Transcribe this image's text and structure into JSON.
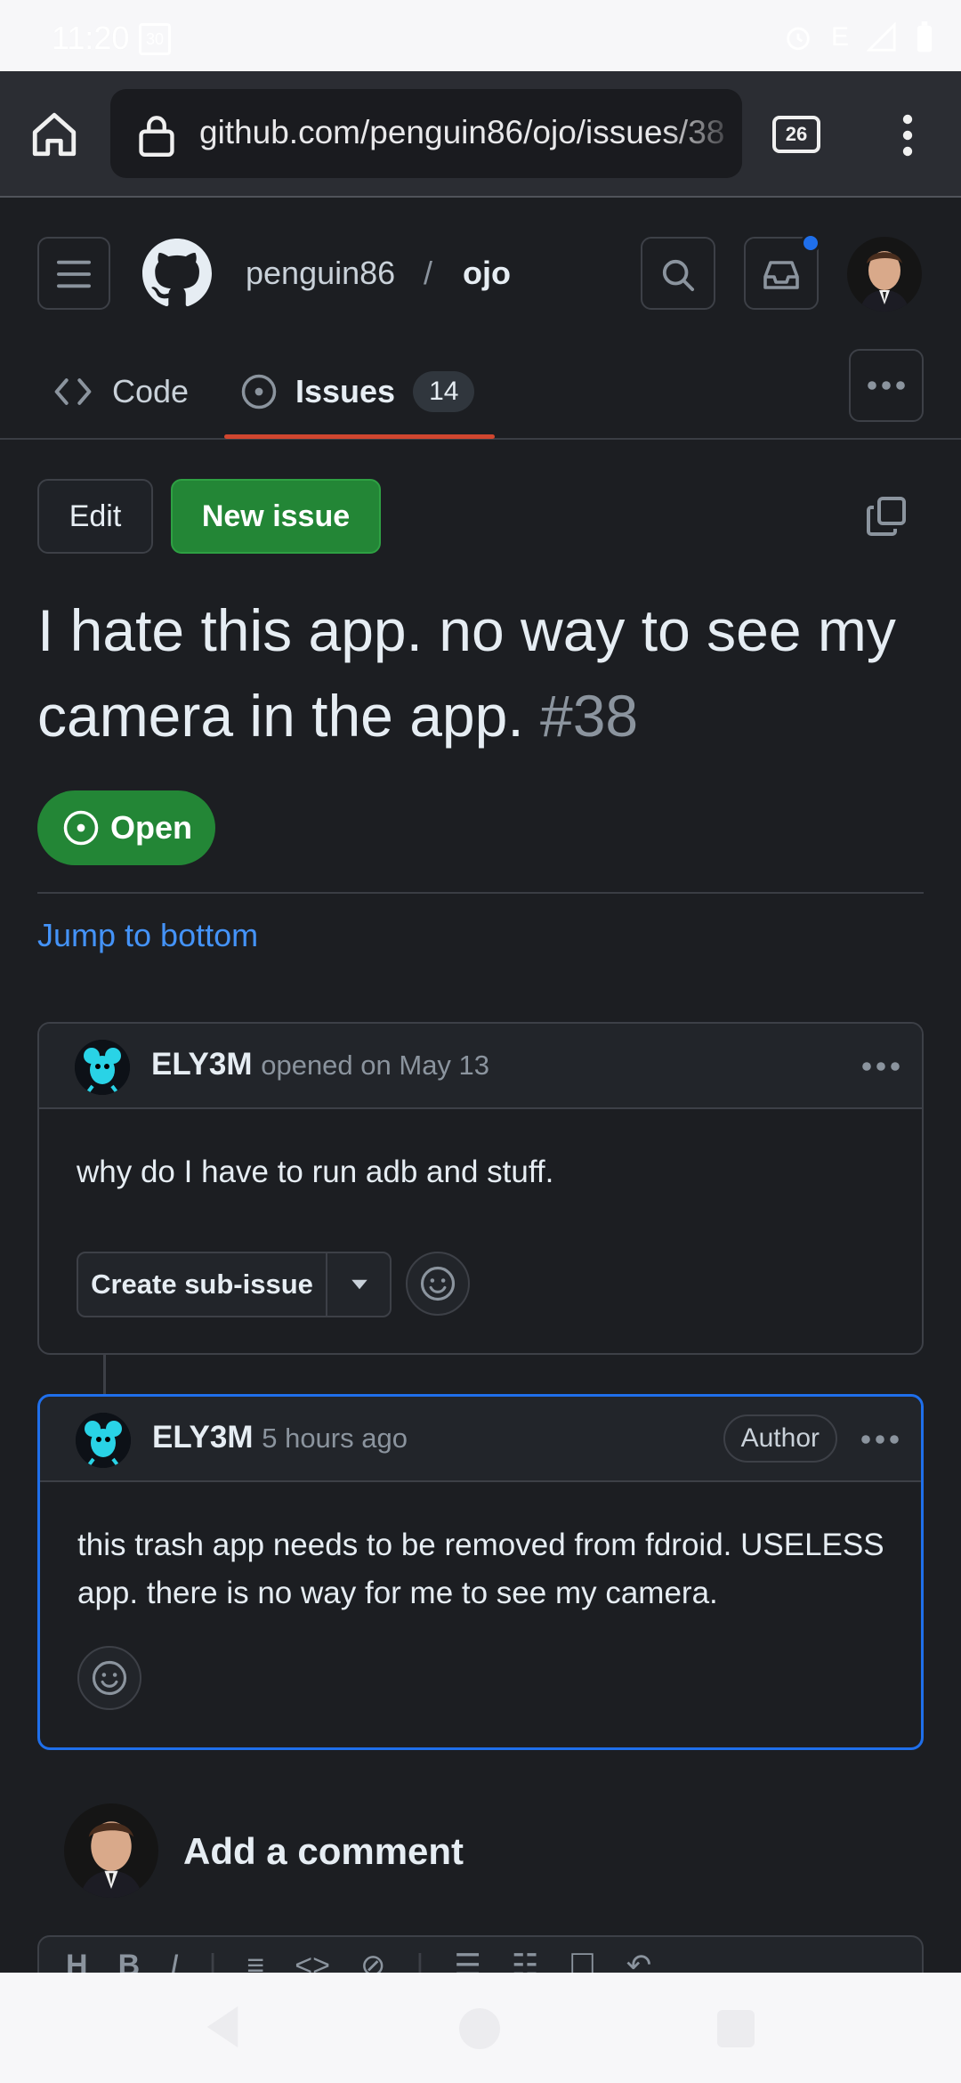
{
  "status_bar": {
    "time": "11:20",
    "calendar_day": "30",
    "network": "E"
  },
  "browser": {
    "url": "github.com/penguin86/ojo/issues/38",
    "tab_count": "26"
  },
  "header": {
    "owner": "penguin86",
    "separator": "/",
    "repo": "ojo",
    "tabs": [
      {
        "label": "Code"
      },
      {
        "label": "Issues",
        "count": "14"
      }
    ]
  },
  "actions": {
    "edit_label": "Edit",
    "new_issue_label": "New issue"
  },
  "issue": {
    "title": "I hate this app. no way to see my camera in the app.",
    "number": "#38",
    "state": "Open",
    "jump_link": "Jump to bottom"
  },
  "comments": [
    {
      "author": "ELY3M",
      "meta": "opened on May 13",
      "body": "why do I have to run adb and stuff.",
      "sub_issue_label": "Create sub-issue"
    },
    {
      "author": "ELY3M",
      "meta": "5 hours ago",
      "badge": "Author",
      "body": "this trash app needs to be removed from fdroid. USELESS app. there is no way for me to see my camera."
    }
  ],
  "composer": {
    "label": "Add a comment"
  },
  "colors": {
    "accent_green": "#238636",
    "link_blue": "#4493f8",
    "tab_underline": "#d0462f",
    "highlight_border": "#1f6feb"
  },
  "icons": [
    "home-icon",
    "lock-icon",
    "tabs-icon",
    "kebab-icon",
    "hamburger-icon",
    "github-logo-icon",
    "search-icon",
    "inbox-icon",
    "code-icon",
    "issue-open-icon",
    "copy-icon",
    "smiley-icon",
    "caret-down-icon",
    "back-icon"
  ]
}
